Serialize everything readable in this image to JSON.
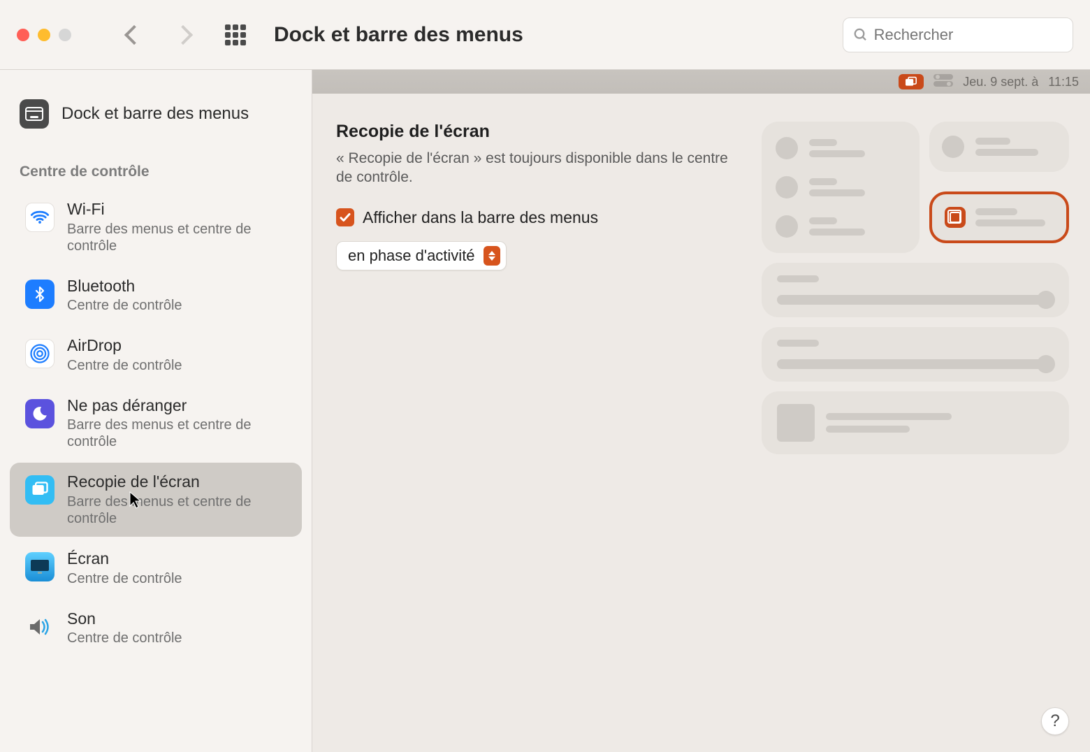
{
  "window": {
    "title": "Dock et barre des menus"
  },
  "toolbar": {
    "search_placeholder": "Rechercher"
  },
  "sidebar": {
    "top_label": "Dock et barre des menus",
    "section_header": "Centre de contrôle",
    "items": [
      {
        "name": "Wi-Fi",
        "sub": "Barre des menus et centre de contrôle"
      },
      {
        "name": "Bluetooth",
        "sub": "Centre de contrôle"
      },
      {
        "name": "AirDrop",
        "sub": "Centre de contrôle"
      },
      {
        "name": "Ne pas déranger",
        "sub": "Barre des menus et centre de contrôle"
      },
      {
        "name": "Recopie de l'écran",
        "sub": "Barre des menus et centre de contrôle"
      },
      {
        "name": "Écran",
        "sub": "Centre de contrôle"
      },
      {
        "name": "Son",
        "sub": "Centre de contrôle"
      }
    ]
  },
  "menubar": {
    "date_text": "Jeu. 9 sept. à",
    "time_text": "11:15"
  },
  "main": {
    "heading": "Recopie de l'écran",
    "description": "« Recopie de l'écran » est toujours disponible dans le centre de contrôle.",
    "checkbox_label": "Afficher dans la barre des menus",
    "select_value": "en phase d'activité"
  },
  "help": {
    "glyph": "?"
  }
}
